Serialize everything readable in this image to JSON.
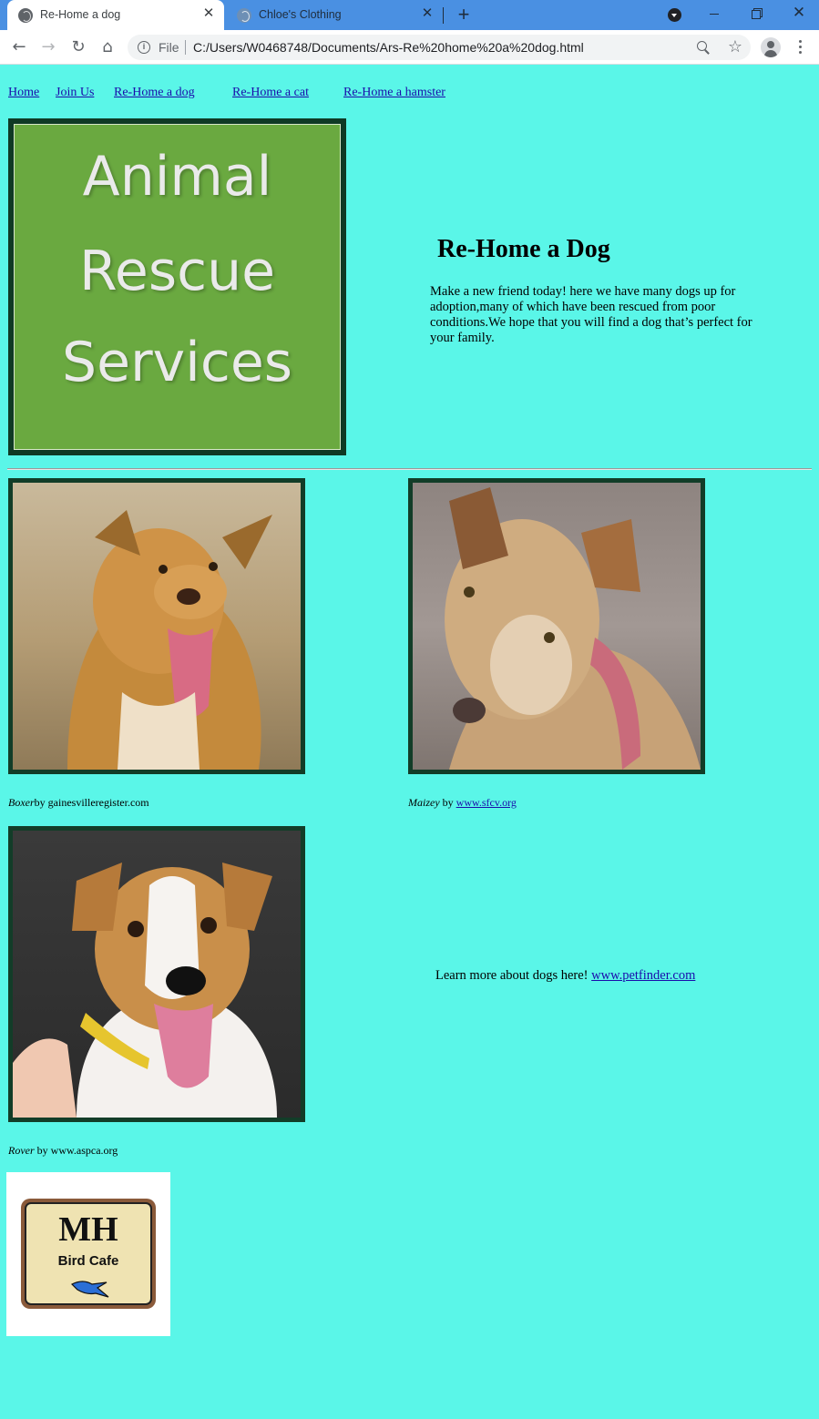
{
  "browser": {
    "tabs": [
      {
        "title": "Re-Home a dog",
        "active": true
      },
      {
        "title": "Chloe's Clothing",
        "active": false
      }
    ],
    "address": {
      "scheme_label": "File",
      "url": "C:/Users/W0468748/Documents/Ars-Re%20home%20a%20dog.html"
    },
    "theme_color": "#4a90e2"
  },
  "page": {
    "background_color": "#5af6e8",
    "nav": [
      "Home",
      "Join Us",
      "Re-Home a dog",
      "Re-Home a cat",
      "Re-Home a hamster"
    ],
    "logo_lines": [
      "Animal",
      "Rescue",
      "Services"
    ],
    "heading": "Re-Home a Dog",
    "intro": "Make a new friend today! here we have many dogs up for  adoption,many of which have been rescued from poor conditions.We hope that you will find a dog that’s perfect for your family.",
    "dogs": [
      {
        "name": "Boxer",
        "by": "by gainesvilleregister.com",
        "link": ""
      },
      {
        "name": "Maizey",
        "by": " by ",
        "link": "www.sfcv.org"
      },
      {
        "name": "Rover",
        "by": " by www.aspca.org",
        "link": ""
      }
    ],
    "learn_more": {
      "text": "Learn more about dogs here! ",
      "link": "www.petfinder.com"
    },
    "cafe_logo": {
      "initials": "MH",
      "name": "Bird Cafe"
    }
  }
}
